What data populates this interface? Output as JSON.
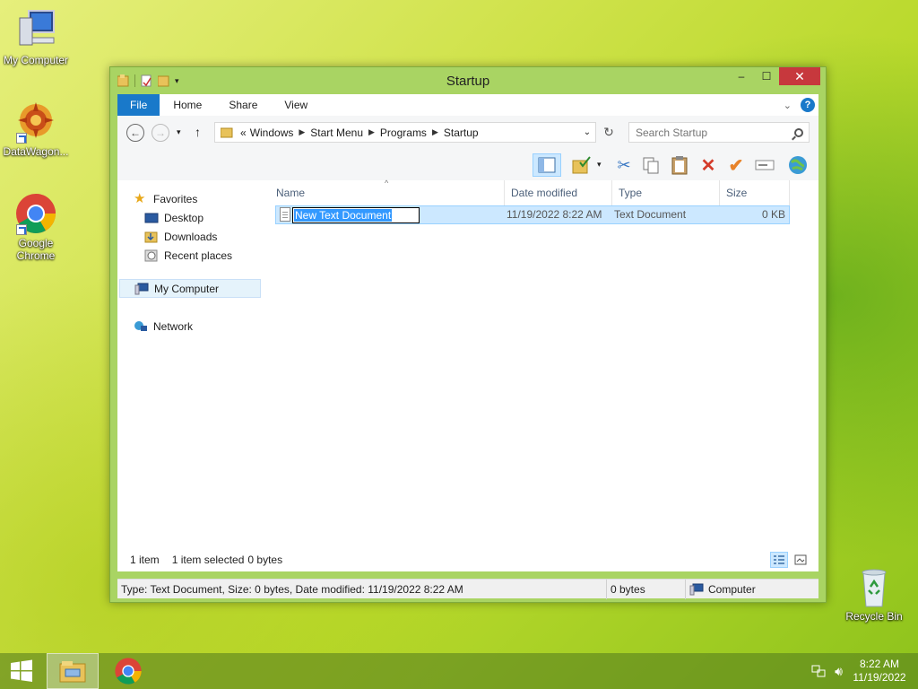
{
  "desktop": {
    "icons": [
      {
        "label": "My Computer"
      },
      {
        "label": "DataWagon..."
      },
      {
        "label": "Google Chrome"
      },
      {
        "label": "Recycle Bin"
      }
    ]
  },
  "window": {
    "title": "Startup",
    "controls": {
      "minimize": "–",
      "maximize": "☐",
      "close": "✕"
    },
    "ribbon_tabs": [
      "File",
      "Home",
      "Share",
      "View"
    ],
    "breadcrumb": {
      "overflow": "«",
      "items": [
        "Windows",
        "Start Menu",
        "Programs",
        "Startup"
      ]
    },
    "search": {
      "placeholder": "Search Startup"
    },
    "nav_pane": {
      "favorites": "Favorites",
      "desktop": "Desktop",
      "downloads": "Downloads",
      "recent": "Recent places",
      "my_computer": "My Computer",
      "network": "Network"
    },
    "columns": [
      "Name",
      "Date modified",
      "Type",
      "Size"
    ],
    "files": [
      {
        "name": "New Text Document",
        "date": "11/19/2022 8:22 AM",
        "type": "Text Document",
        "size": "0 KB"
      }
    ],
    "info": {
      "count": "1 item",
      "selected": "1 item selected",
      "bytes": "0 bytes"
    },
    "statusbar": {
      "details": "Type: Text Document, Size: 0 bytes, Date modified: 11/19/2022 8:22 AM",
      "size": "0 bytes",
      "location": "Computer"
    }
  },
  "taskbar": {
    "time": "8:22 AM",
    "date": "11/19/2022"
  },
  "colors": {
    "accent": "#1979ca",
    "window_frame": "#a9d463",
    "selection": "#cce8ff",
    "close": "#c7383d"
  }
}
